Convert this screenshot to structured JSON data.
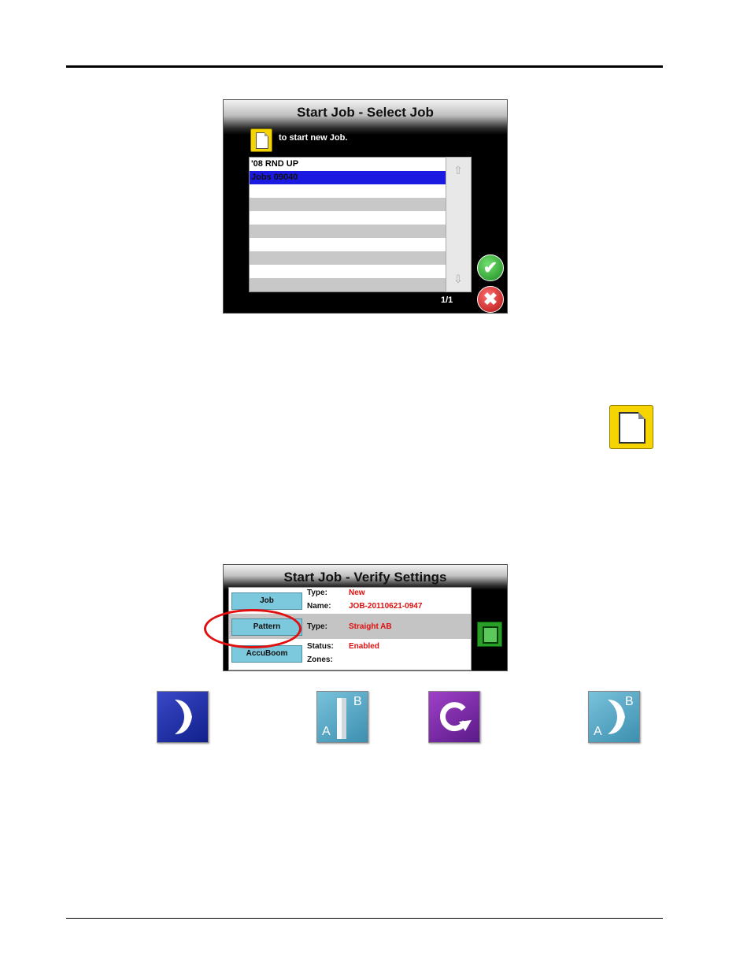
{
  "screen1": {
    "title": "Start Job - Select Job",
    "new_hint": "to start new Job.",
    "list_items": [
      "'08 RND UP",
      "Jobs 09040",
      "",
      "",
      "",
      "",
      "",
      "",
      "",
      ""
    ],
    "page_indicator": "1/1",
    "colors": {
      "selected": "#1a1ae0",
      "ok": "#1f8a1f",
      "cancel": "#b01010"
    }
  },
  "screen2": {
    "title": "Start Job - Verify Settings",
    "buttons": {
      "job": "Job",
      "pattern": "Pattern",
      "accuboom": "AccuBoom"
    },
    "fields": {
      "type_label": "Type:",
      "type_value": "New",
      "name_label": "Name:",
      "name_value": "JOB-20110621-0947",
      "pattern_type_label": "Type:",
      "pattern_type_value": "Straight AB",
      "status_label": "Status:",
      "status_value": "Enabled",
      "zones_label": "Zones:",
      "zones_value": ""
    },
    "colors": {
      "value_text": "#e01010",
      "button": "#7cc9de",
      "callout": "#e01010"
    }
  },
  "pattern_icons": {
    "curved": {
      "icon": "curved-pattern-icon"
    },
    "straight_ab": {
      "icon": "straight-ab-icon",
      "a": "A",
      "b": "B"
    },
    "pivot": {
      "icon": "pivot-icon"
    },
    "curved_ab": {
      "icon": "curved-ab-icon",
      "a": "A",
      "b": "B"
    }
  }
}
